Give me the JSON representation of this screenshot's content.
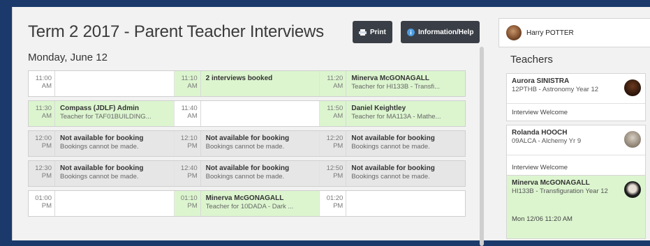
{
  "header": {
    "title": "Term 2 2017 - Parent Teacher Interviews",
    "print_label": "Print",
    "info_label": "Information/Help",
    "user_name": "Harry POTTER"
  },
  "schedule": {
    "day": "Monday, June 12",
    "rows": [
      {
        "status": "open",
        "slots": [
          {
            "time": "11:00",
            "ampm": "AM",
            "booked": false,
            "title": "",
            "detail": ""
          },
          {
            "time": "11:10",
            "ampm": "AM",
            "booked": true,
            "title": "2 interviews booked",
            "detail": ""
          },
          {
            "time": "11:20",
            "ampm": "AM",
            "booked": true,
            "title": "Minerva McGONAGALL",
            "detail": "Teacher for HI133B - Transfi..."
          }
        ]
      },
      {
        "status": "open",
        "slots": [
          {
            "time": "11:30",
            "ampm": "AM",
            "booked": true,
            "title": "Compass (JDLF) Admin",
            "detail": "Teacher for TAF01BUILDING..."
          },
          {
            "time": "11:40",
            "ampm": "AM",
            "booked": false,
            "title": "",
            "detail": ""
          },
          {
            "time": "11:50",
            "ampm": "AM",
            "booked": true,
            "title": "Daniel Keightley",
            "detail": "Teacher for MA113A - Mathe..."
          }
        ]
      },
      {
        "status": "unavailable",
        "slots": [
          {
            "time": "12:00",
            "ampm": "PM",
            "booked": false,
            "title": "Not available for booking",
            "detail": "Bookings cannot be made."
          },
          {
            "time": "12:10",
            "ampm": "PM",
            "booked": false,
            "title": "Not available for booking",
            "detail": "Bookings cannot be made."
          },
          {
            "time": "12:20",
            "ampm": "PM",
            "booked": false,
            "title": "Not available for booking",
            "detail": "Bookings cannot be made."
          }
        ]
      },
      {
        "status": "unavailable",
        "slots": [
          {
            "time": "12:30",
            "ampm": "PM",
            "booked": false,
            "title": "Not available for booking",
            "detail": "Bookings cannot be made."
          },
          {
            "time": "12:40",
            "ampm": "PM",
            "booked": false,
            "title": "Not available for booking",
            "detail": "Bookings cannot be made."
          },
          {
            "time": "12:50",
            "ampm": "PM",
            "booked": false,
            "title": "Not available for booking",
            "detail": "Bookings cannot be made."
          }
        ]
      },
      {
        "status": "open",
        "slots": [
          {
            "time": "01:00",
            "ampm": "PM",
            "booked": false,
            "title": "",
            "detail": ""
          },
          {
            "time": "01:10",
            "ampm": "PM",
            "booked": true,
            "title": "Minerva McGONAGALL",
            "detail": "Teacher for 10DADA - Dark ..."
          },
          {
            "time": "01:20",
            "ampm": "PM",
            "booked": false,
            "title": "",
            "detail": ""
          }
        ]
      }
    ]
  },
  "teachers": {
    "title": "Teachers",
    "items": [
      {
        "name": "Aurora SINISTRA",
        "subject": "12PTHB - Astronomy Year 12",
        "footer": "Interview Welcome",
        "booked": false
      },
      {
        "name": "Rolanda HOOCH",
        "subject": "09ALCA - Alchemy Yr 9",
        "footer": "Interview Welcome",
        "booked": false
      },
      {
        "name": "Minerva McGONAGALL",
        "subject": "HI133B - Transfiguration Year 12",
        "footer": "Mon 12/06 11:20 AM",
        "booked": true
      }
    ]
  },
  "colors": {
    "booked_bg": "#dcf5cf",
    "unavailable_bg": "#e6e6e6",
    "button_bg": "#3a3f47",
    "page_bg": "#1b3a6b"
  }
}
